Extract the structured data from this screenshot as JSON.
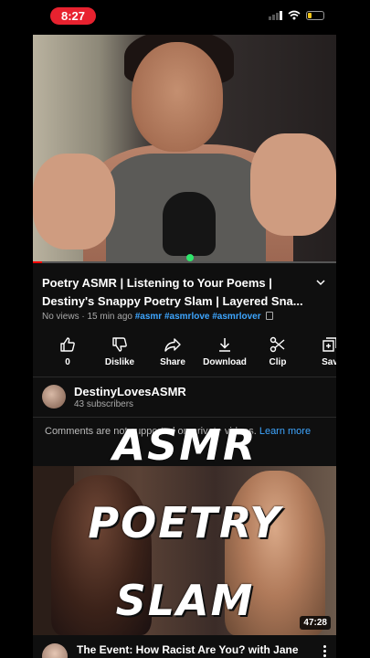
{
  "status_bar": {
    "time": "8:27",
    "battery_color": "#f0c419",
    "time_pill_color": "#e8222f"
  },
  "video": {
    "progress": 0.03
  },
  "video_info": {
    "title": "Poetry ASMR | Listening to Your Poems | Destiny's Snappy Poetry Slam | Layered Sna...",
    "views": "No views",
    "age": "15 min ago",
    "hashtags": [
      "#asmr",
      "#asmrlove",
      "#asmrlover"
    ]
  },
  "actions": [
    {
      "label": "0",
      "icon": "thumbs-up-icon"
    },
    {
      "label": "Dislike",
      "icon": "thumbs-down-icon"
    },
    {
      "label": "Share",
      "icon": "share-icon"
    },
    {
      "label": "Download",
      "icon": "download-icon"
    },
    {
      "label": "Clip",
      "icon": "scissors-icon"
    },
    {
      "label": "Sav",
      "icon": "save-icon"
    }
  ],
  "channel": {
    "name": "DestinyLovesASMR",
    "subscribers": "43 subscribers"
  },
  "comments": {
    "text_before": "Comments are ",
    "text_hidden": "no",
    "text_after": "t supported on private videos.",
    "link": "Learn more"
  },
  "next_video": {
    "duration": "47:28",
    "title": "The Event: How Racist Are You? with Jane"
  },
  "overlay": {
    "lines": [
      "ASMR",
      "POETRY",
      "SLAM"
    ]
  }
}
